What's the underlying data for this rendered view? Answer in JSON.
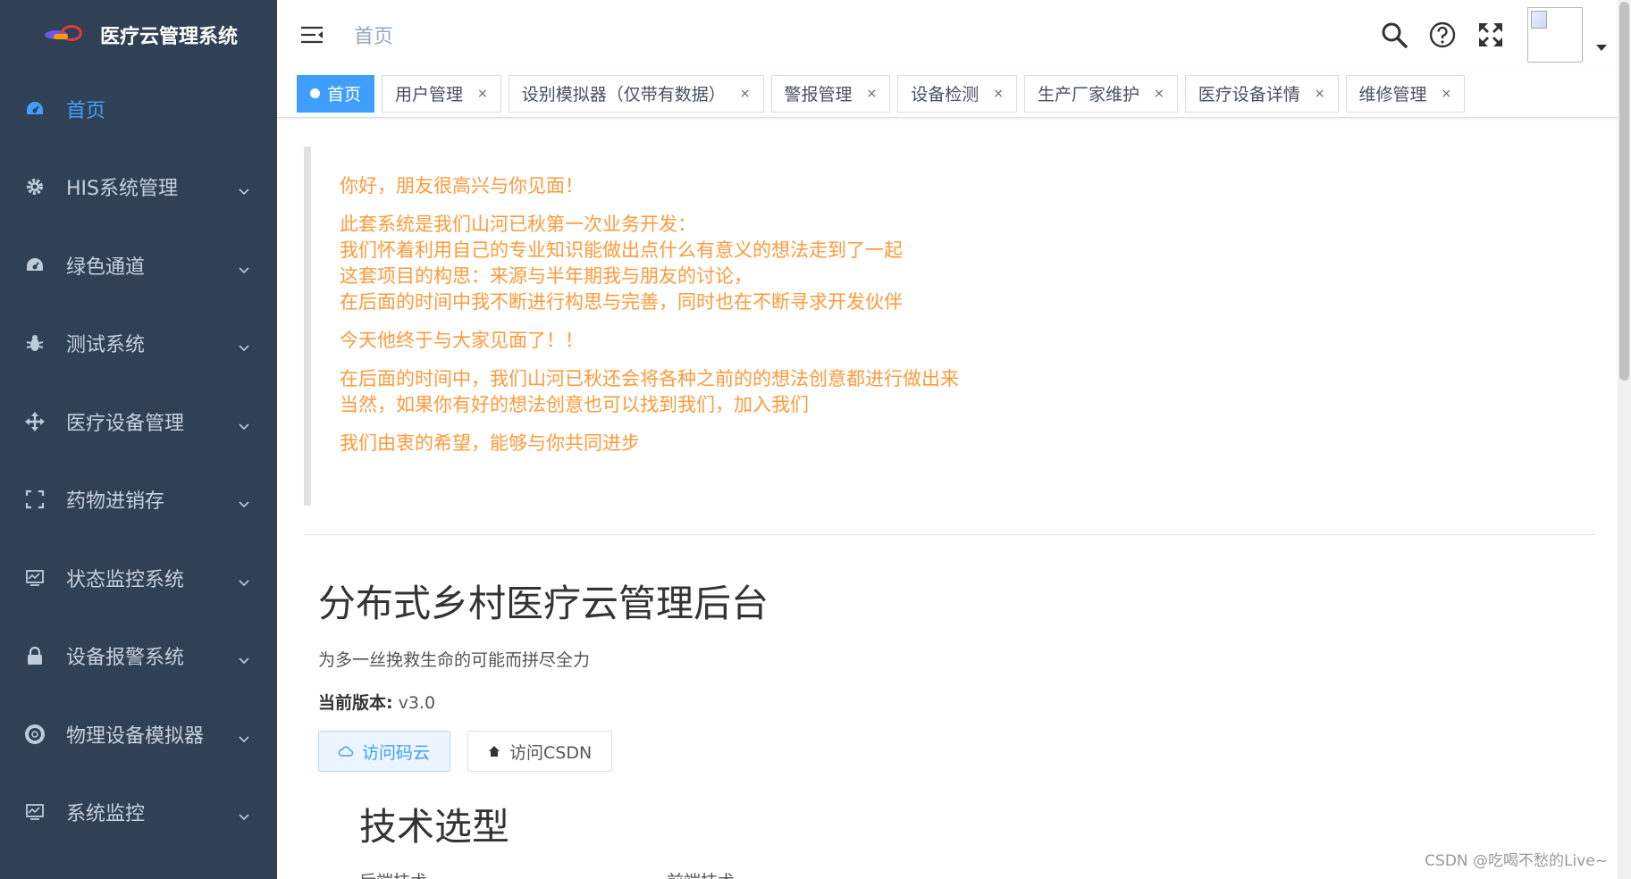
{
  "sidebar": {
    "brand_title": "医疗云管理系统",
    "items": [
      {
        "label": "首页",
        "icon": "dashboard-icon"
      },
      {
        "label": "HIS系统管理",
        "icon": "gear-icon"
      },
      {
        "label": "绿色通道",
        "icon": "dashboard-icon"
      },
      {
        "label": "测试系统",
        "icon": "bug-icon"
      },
      {
        "label": "医疗设备管理",
        "icon": "move-icon"
      },
      {
        "label": "药物进销存",
        "icon": "expand-icon"
      },
      {
        "label": "状态监控系统",
        "icon": "monitor-icon"
      },
      {
        "label": "设备报警系统",
        "icon": "lock-icon"
      },
      {
        "label": "物理设备模拟器",
        "icon": "lifebuoy-icon"
      },
      {
        "label": "系统监控",
        "icon": "monitor-icon"
      }
    ]
  },
  "header": {
    "breadcrumb": "首页"
  },
  "tags": [
    {
      "label": "首页",
      "active": true
    },
    {
      "label": "用户管理",
      "close": "×"
    },
    {
      "label": "设别模拟器（仅带有数据）",
      "close": "×"
    },
    {
      "label": "警报管理",
      "close": "×"
    },
    {
      "label": "设备检测",
      "close": "×"
    },
    {
      "label": "生产厂家维护",
      "close": "×"
    },
    {
      "label": "医疗设备详情",
      "close": "×"
    },
    {
      "label": "维修管理",
      "close": "×"
    }
  ],
  "welcome": {
    "lines": [
      "你好，朋友很高兴与你见面！",
      "此套系统是我们山河已秋第一次业务开发：",
      "我们怀着利用自己的专业知识能做出点什么有意义的想法走到了一起",
      "这套项目的构思：来源与半年期我与朋友的讨论，",
      "在后面的时间中我不断进行构思与完善，同时也在不断寻求开发伙伴",
      "今天他终于与大家见面了！！",
      "在后面的时间中，我们山河已秋还会将各种之前的的想法创意都进行做出来",
      "当然，如果你有好的想法创意也可以找到我们，加入我们",
      "我们由衷的希望，能够与你共同进步"
    ]
  },
  "hero": {
    "title": "分布式乡村医疗云管理后台",
    "subtitle": "为多一丝挽救生命的可能而拼尽全力",
    "version_label": "当前版本:",
    "version_value": " v3.0",
    "btn_gitee": "访问码云",
    "btn_csdn": "访问CSDN"
  },
  "tech": {
    "title": "技术选型",
    "backend": "后端技术",
    "frontend": "前端技术"
  },
  "watermark": "CSDN @吃喝不愁的Live~",
  "colors": {
    "sidebar_bg": "#304156",
    "accent": "#409eff",
    "welcome_text": "#ff9a3a"
  }
}
